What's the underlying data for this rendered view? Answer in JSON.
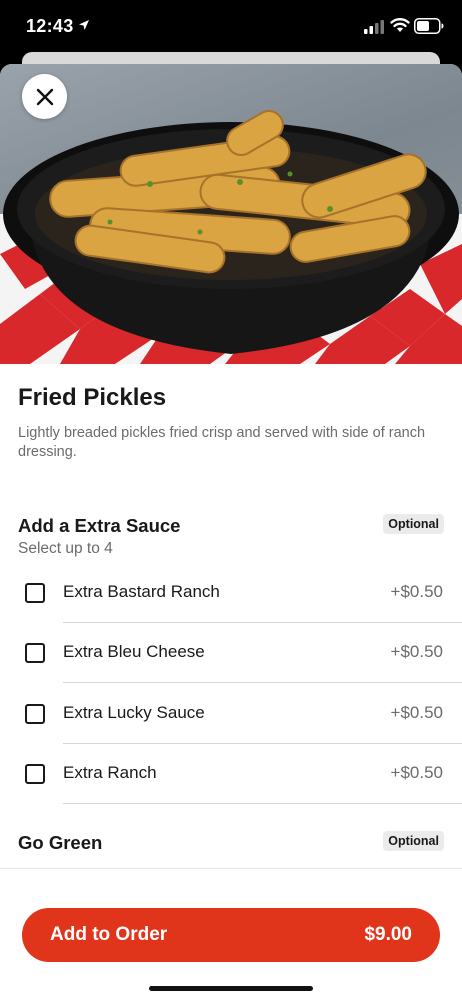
{
  "status_bar": {
    "time": "12:43"
  },
  "icons": {
    "location": "location-arrow-icon",
    "signal": "cellular-signal-icon",
    "wifi": "wifi-icon",
    "battery": "battery-icon",
    "close": "close-icon"
  },
  "item": {
    "title": "Fried Pickles",
    "description": "Lightly breaded pickles fried crisp and served with side of ranch dressing."
  },
  "groups": [
    {
      "title": "Add a Extra Sauce",
      "badge": "Optional",
      "subtitle": "Select up to 4",
      "options": [
        {
          "label": "Extra Bastard Ranch",
          "price": "+$0.50",
          "checked": false
        },
        {
          "label": "Extra Bleu Cheese",
          "price": "+$0.50",
          "checked": false
        },
        {
          "label": "Extra Lucky Sauce",
          "price": "+$0.50",
          "checked": false
        },
        {
          "label": "Extra Ranch",
          "price": "+$0.50",
          "checked": false
        }
      ]
    },
    {
      "title": "Go Green",
      "badge": "Optional"
    }
  ],
  "footer": {
    "button_label": "Add to Order",
    "button_price": "$9.00"
  },
  "colors": {
    "accent": "#e0341b",
    "text_primary": "#191919",
    "text_secondary": "#6b6b6b"
  }
}
